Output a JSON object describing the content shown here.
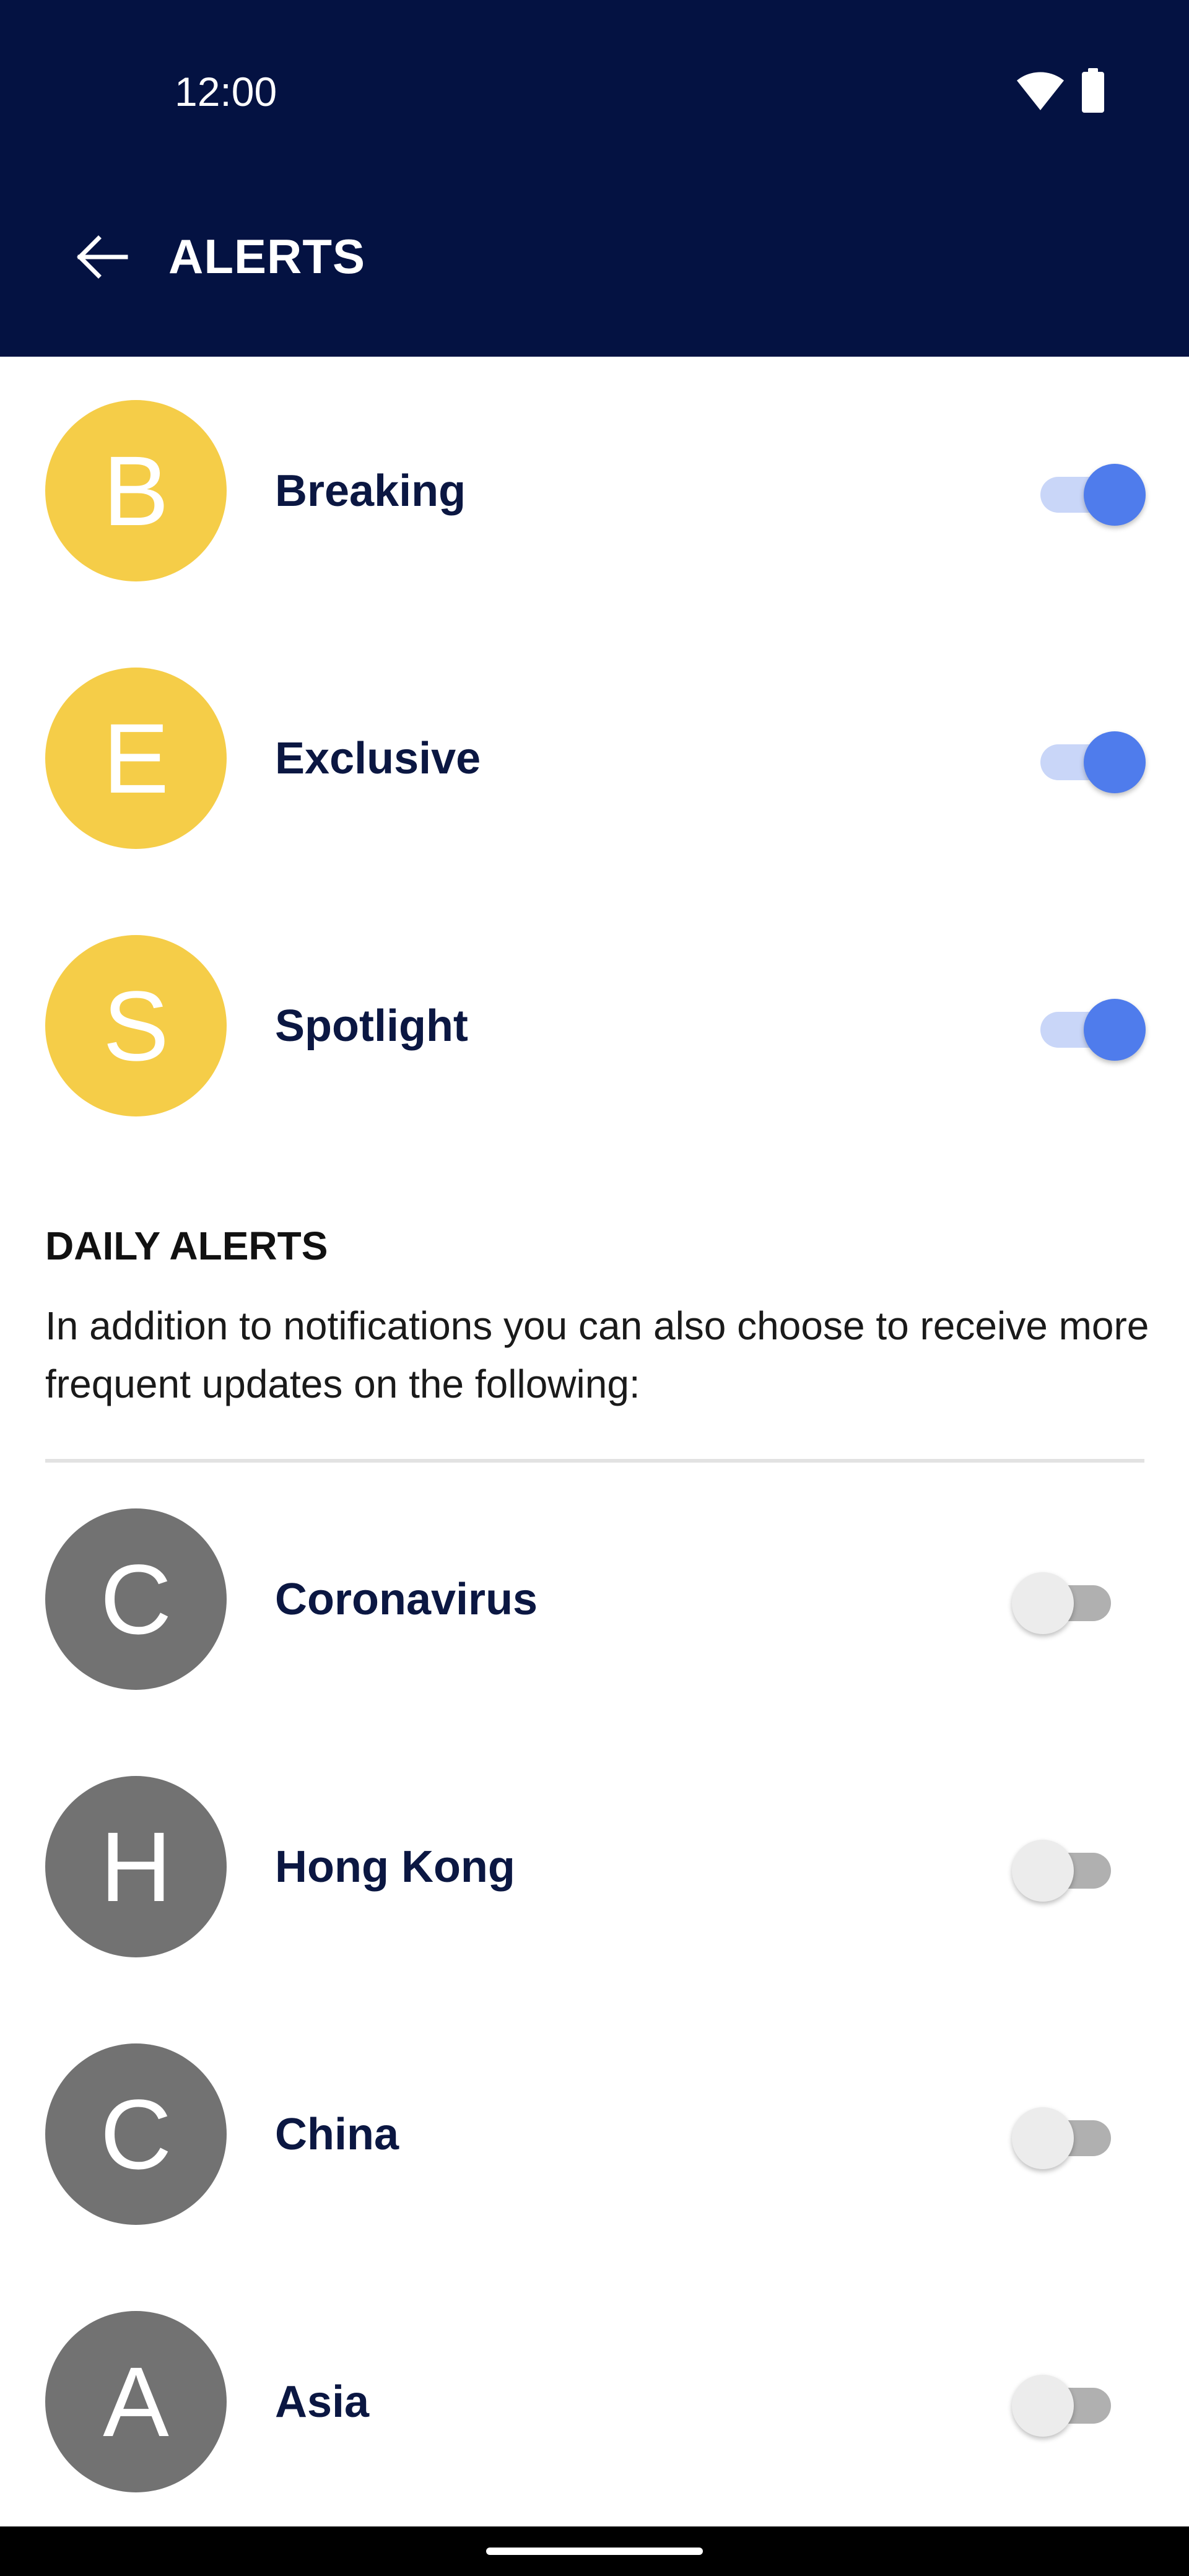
{
  "status_bar": {
    "time": "12:00",
    "icons": [
      "wifi-icon",
      "battery-icon"
    ]
  },
  "app_bar": {
    "title": "ALERTS",
    "back_icon": "arrow-left-icon"
  },
  "colors": {
    "app_bar_bg": "#041242",
    "label_text": "#0b1742",
    "avatar_yellow": "#f5cd48",
    "avatar_grey": "#727272",
    "toggle_on": "#4f7cec",
    "toggle_on_track": "#c9d6f8",
    "toggle_off_thumb": "#ececec",
    "toggle_off_track": "#b0b0b0"
  },
  "alerts": [
    {
      "initial": "B",
      "label": "Breaking",
      "enabled": true
    },
    {
      "initial": "E",
      "label": "Exclusive",
      "enabled": true
    },
    {
      "initial": "S",
      "label": "Spotlight",
      "enabled": true
    }
  ],
  "daily_alerts": {
    "title": "DAILY ALERTS",
    "description": "In addition to notifications you can also choose to receive more frequent updates on the following:",
    "items": [
      {
        "initial": "C",
        "label": "Coronavirus",
        "enabled": false
      },
      {
        "initial": "H",
        "label": "Hong Kong",
        "enabled": false
      },
      {
        "initial": "C",
        "label": "China",
        "enabled": false
      },
      {
        "initial": "A",
        "label": "Asia",
        "enabled": false
      }
    ]
  }
}
